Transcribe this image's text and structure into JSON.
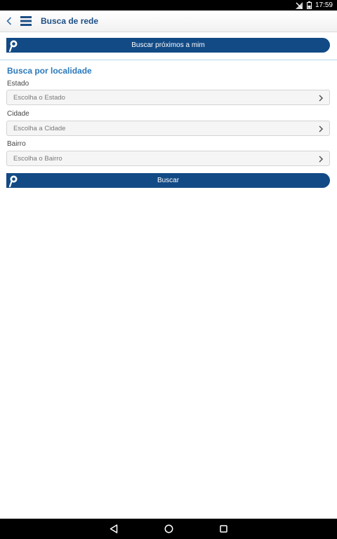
{
  "status_bar": {
    "time": "17:59",
    "icons": [
      "signal-off-icon",
      "battery-icon"
    ]
  },
  "app_bar": {
    "title": "Busca de rede",
    "back_icon": "chevron-left-icon",
    "menu_icon": "menu-icon"
  },
  "near_button": {
    "label": "Buscar próximos a mim",
    "icon": "location-pin-icon"
  },
  "section": {
    "title": "Busca por localidade"
  },
  "fields": [
    {
      "label": "Estado",
      "placeholder": "Escolha o Estado"
    },
    {
      "label": "Cidade",
      "placeholder": "Escolha a Cidade"
    },
    {
      "label": "Bairro",
      "placeholder": "Escolha o Bairro"
    }
  ],
  "search_button": {
    "label": "Buscar",
    "icon": "location-pin-icon"
  },
  "nav_bar": {
    "icons": [
      "back-triangle-icon",
      "home-circle-icon",
      "recents-square-icon"
    ]
  },
  "colors": {
    "primary": "#124a85",
    "title": "#1d4f86",
    "section_title": "#2b79bb",
    "status_bar": "#000000"
  }
}
